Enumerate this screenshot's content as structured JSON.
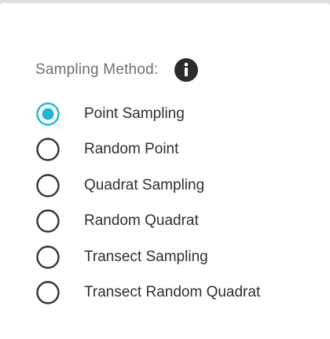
{
  "sampling": {
    "label": "Sampling Method:",
    "info_icon": "info-icon",
    "accent_color": "#1fb6d6",
    "options": [
      {
        "label": "Point Sampling",
        "selected": true
      },
      {
        "label": "Random Point",
        "selected": false
      },
      {
        "label": "Quadrat Sampling",
        "selected": false
      },
      {
        "label": "Random Quadrat",
        "selected": false
      },
      {
        "label": "Transect Sampling",
        "selected": false
      },
      {
        "label": "Transect Random Quadrat",
        "selected": false
      }
    ]
  }
}
